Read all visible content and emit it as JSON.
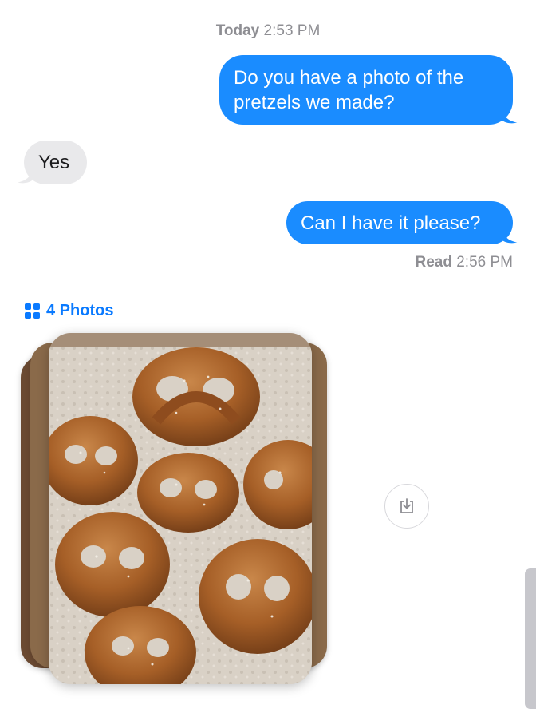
{
  "conversation": {
    "timestamp": {
      "day": "Today",
      "time": "2:53 PM"
    },
    "messages": [
      {
        "direction": "outgoing",
        "text": "Do you have a photo of the pretzels we made?"
      },
      {
        "direction": "incoming",
        "text": "Yes"
      },
      {
        "direction": "outgoing",
        "text": "Can I have it please?"
      }
    ],
    "read_receipt": {
      "label": "Read",
      "time": "2:56 PM"
    },
    "attachment": {
      "link_text": "4 Photos",
      "icon": "grid-icon",
      "save_icon": "download-icon"
    }
  },
  "colors": {
    "outgoing_bubble": "#1a8cff",
    "incoming_bubble": "#e9e9eb",
    "link": "#0a7aff",
    "meta_text": "#8e8e93"
  }
}
